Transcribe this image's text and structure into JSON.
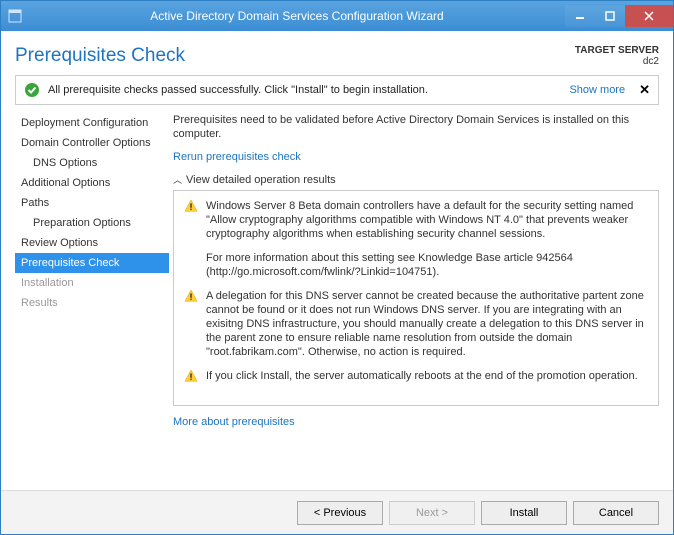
{
  "window": {
    "title": "Active Directory Domain Services Configuration Wizard"
  },
  "page": {
    "title": "Prerequisites Check",
    "target_label": "TARGET SERVER",
    "target_value": "dc2"
  },
  "status": {
    "message": "All prerequisite checks passed successfully. Click \"Install\" to begin installation.",
    "show_more": "Show more"
  },
  "sidebar": {
    "items": [
      {
        "label": "Deployment Configuration",
        "indent": false
      },
      {
        "label": "Domain Controller Options",
        "indent": false
      },
      {
        "label": "DNS Options",
        "indent": true
      },
      {
        "label": "Additional Options",
        "indent": false
      },
      {
        "label": "Paths",
        "indent": false
      },
      {
        "label": "Preparation Options",
        "indent": true
      },
      {
        "label": "Review Options",
        "indent": false
      },
      {
        "label": "Prerequisites Check",
        "indent": false,
        "selected": true
      },
      {
        "label": "Installation",
        "indent": false,
        "disabled": true
      },
      {
        "label": "Results",
        "indent": false,
        "disabled": true
      }
    ]
  },
  "main": {
    "intro": "Prerequisites need to be validated before Active Directory Domain Services is installed on this computer.",
    "rerun_link": "Rerun prerequisites check",
    "view_results_label": "View detailed operation results",
    "warnings": [
      {
        "paragraphs": [
          "Windows Server 8 Beta domain controllers have a default for the security setting named \"Allow cryptography algorithms compatible with Windows NT 4.0\" that prevents weaker cryptography algorithms when establishing security channel sessions.",
          "For more information about this setting see Knowledge Base article 942564 (http://go.microsoft.com/fwlink/?Linkid=104751)."
        ]
      },
      {
        "paragraphs": [
          "A delegation for this DNS server cannot be created because the authoritative partent zone cannot be found or it does not run Windows DNS server. If you are integrating with an exisitng DNS infrastructure, you should manually create a delegation to this DNS server in the parent zone to ensure reliable name resolution from outside the domain \"root.fabrikam.com\". Otherwise, no action is required."
        ]
      },
      {
        "paragraphs": [
          "If you click Install, the server automatically reboots at the end of the promotion operation."
        ]
      }
    ],
    "more_link": "More about prerequisites"
  },
  "footer": {
    "previous": "< Previous",
    "next": "Next >",
    "install": "Install",
    "cancel": "Cancel"
  }
}
